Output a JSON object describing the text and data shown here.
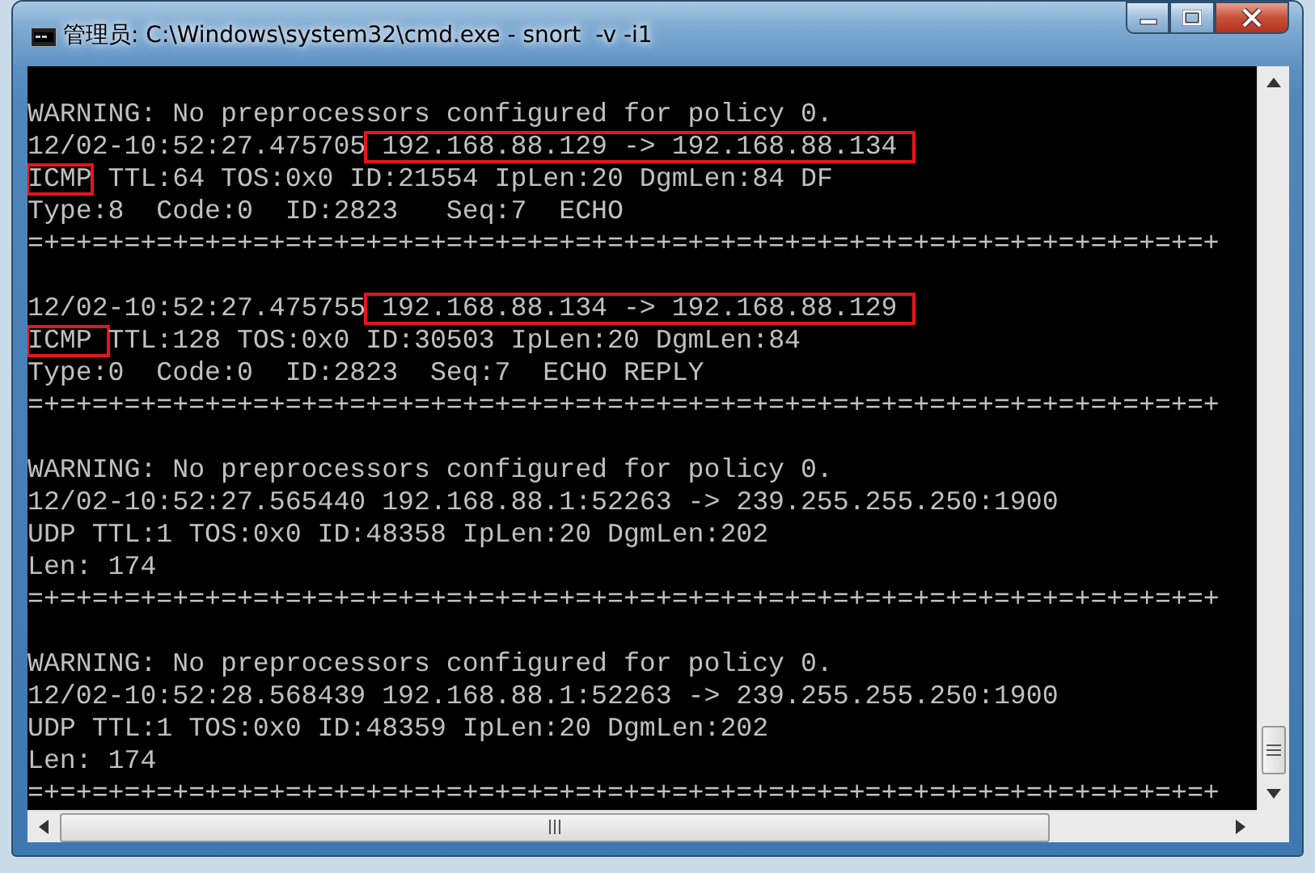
{
  "window": {
    "title": "管理员: C:\\Windows\\system32\\cmd.exe - snort  -v -i1"
  },
  "console": {
    "lines": [
      {
        "kind": "blank"
      },
      {
        "kind": "text",
        "segments": [
          {
            "text": "WARNING: No preprocessors configured for policy 0.",
            "boxed": false
          }
        ]
      },
      {
        "kind": "text",
        "segments": [
          {
            "text": "12/02-10:52:27.475705",
            "boxed": false
          },
          {
            "text": " 192.168.88.129 -> 192.168.88.134 ",
            "boxed": true
          }
        ]
      },
      {
        "kind": "text",
        "segments": [
          {
            "text": "ICMP",
            "boxed": true
          },
          {
            "text": " TTL:64 TOS:0x0 ID:21554 IpLen:20 DgmLen:84 DF",
            "boxed": false
          }
        ]
      },
      {
        "kind": "text",
        "segments": [
          {
            "text": "Type:8  Code:0  ID:2823   Seq:7  ECHO",
            "boxed": false
          }
        ]
      },
      {
        "kind": "text",
        "segments": [
          {
            "text": "=+=+=+=+=+=+=+=+=+=+=+=+=+=+=+=+=+=+=+=+=+=+=+=+=+=+=+=+=+=+=+=+=+=+=+=+=+",
            "boxed": false
          }
        ]
      },
      {
        "kind": "blank"
      },
      {
        "kind": "text",
        "segments": [
          {
            "text": "12/02-10:52:27.475755",
            "boxed": false
          },
          {
            "text": " 192.168.88.134 -> 192.168.88.129 ",
            "boxed": true
          }
        ]
      },
      {
        "kind": "text",
        "segments": [
          {
            "text": "ICMP ",
            "boxed": true
          },
          {
            "text": "TTL:128 TOS:0x0 ID:30503 IpLen:20 DgmLen:84",
            "boxed": false
          }
        ]
      },
      {
        "kind": "text",
        "segments": [
          {
            "text": "Type:0  Code:0  ID:2823  Seq:7  ECHO REPLY",
            "boxed": false
          }
        ]
      },
      {
        "kind": "text",
        "segments": [
          {
            "text": "=+=+=+=+=+=+=+=+=+=+=+=+=+=+=+=+=+=+=+=+=+=+=+=+=+=+=+=+=+=+=+=+=+=+=+=+=+",
            "boxed": false
          }
        ]
      },
      {
        "kind": "blank"
      },
      {
        "kind": "text",
        "segments": [
          {
            "text": "WARNING: No preprocessors configured for policy 0.",
            "boxed": false
          }
        ]
      },
      {
        "kind": "text",
        "segments": [
          {
            "text": "12/02-10:52:27.565440 192.168.88.1:52263 -> 239.255.255.250:1900",
            "boxed": false
          }
        ]
      },
      {
        "kind": "text",
        "segments": [
          {
            "text": "UDP TTL:1 TOS:0x0 ID:48358 IpLen:20 DgmLen:202",
            "boxed": false
          }
        ]
      },
      {
        "kind": "text",
        "segments": [
          {
            "text": "Len: 174",
            "boxed": false
          }
        ]
      },
      {
        "kind": "text",
        "segments": [
          {
            "text": "=+=+=+=+=+=+=+=+=+=+=+=+=+=+=+=+=+=+=+=+=+=+=+=+=+=+=+=+=+=+=+=+=+=+=+=+=+",
            "boxed": false
          }
        ]
      },
      {
        "kind": "blank"
      },
      {
        "kind": "text",
        "segments": [
          {
            "text": "WARNING: No preprocessors configured for policy 0.",
            "boxed": false
          }
        ]
      },
      {
        "kind": "text",
        "segments": [
          {
            "text": "12/02-10:52:28.568439 192.168.88.1:52263 -> 239.255.255.250:1900",
            "boxed": false
          }
        ]
      },
      {
        "kind": "text",
        "segments": [
          {
            "text": "UDP TTL:1 TOS:0x0 ID:48359 IpLen:20 DgmLen:202",
            "boxed": false
          }
        ]
      },
      {
        "kind": "text",
        "segments": [
          {
            "text": "Len: 174",
            "boxed": false
          }
        ]
      },
      {
        "kind": "text",
        "segments": [
          {
            "text": "=+=+=+=+=+=+=+=+=+=+=+=+=+=+=+=+=+=+=+=+=+=+=+=+=+=+=+=+=+=+=+=+=+=+=+=+=+",
            "boxed": false
          }
        ]
      }
    ]
  }
}
